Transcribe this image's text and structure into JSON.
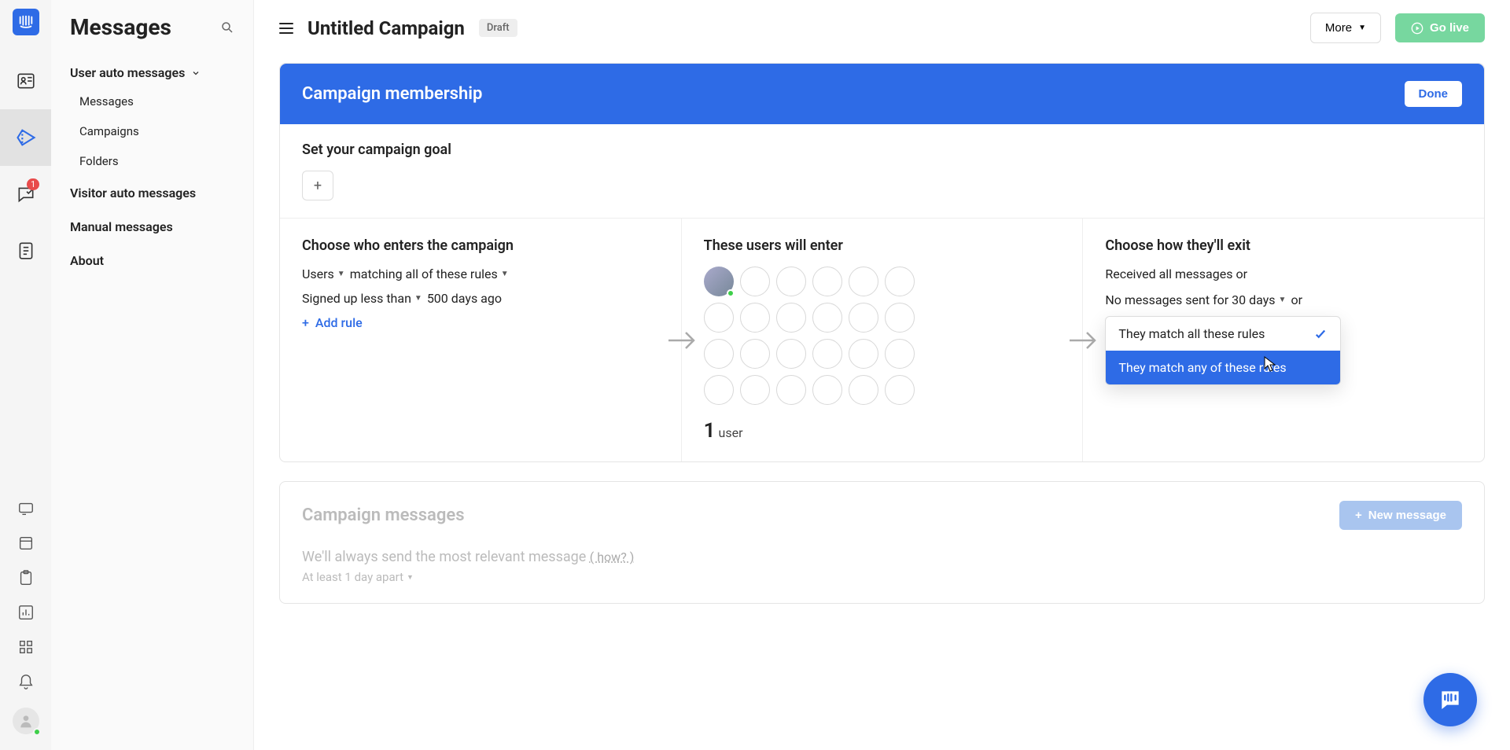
{
  "rail": {
    "inbox_badge": "1"
  },
  "sidebar": {
    "title": "Messages",
    "section1": {
      "label": "User auto messages"
    },
    "subitems": {
      "messages": "Messages",
      "campaigns": "Campaigns",
      "folders": "Folders"
    },
    "visitor_auto": "Visitor auto messages",
    "manual": "Manual messages",
    "about": "About"
  },
  "topbar": {
    "campaign_title": "Untitled Campaign",
    "draft": "Draft",
    "more": "More",
    "go_live": "Go live"
  },
  "membership": {
    "header": "Campaign membership",
    "done": "Done",
    "goal_title": "Set your campaign goal"
  },
  "col1": {
    "title": "Choose who enters the campaign",
    "users": "Users",
    "matching": "matching all of these rules",
    "rule1a": "Signed up less than",
    "rule1b": "500 days ago",
    "add_rule": "Add rule"
  },
  "col2": {
    "title": "These users will enter",
    "count": "1",
    "count_label": "user"
  },
  "col3": {
    "title": "Choose how they'll exit",
    "line1": "Received all messages or",
    "line2a": "No messages sent for 30 days",
    "line2b": "or",
    "match_label": "They match all these rules",
    "dd_option1": "They match all these rules",
    "dd_option2": "They match any of these rules"
  },
  "cm": {
    "title": "Campaign messages",
    "new_msg": "New message",
    "relevant": "We'll always send the most relevant message",
    "how": "( how? )",
    "apart": "At least 1 day apart"
  }
}
